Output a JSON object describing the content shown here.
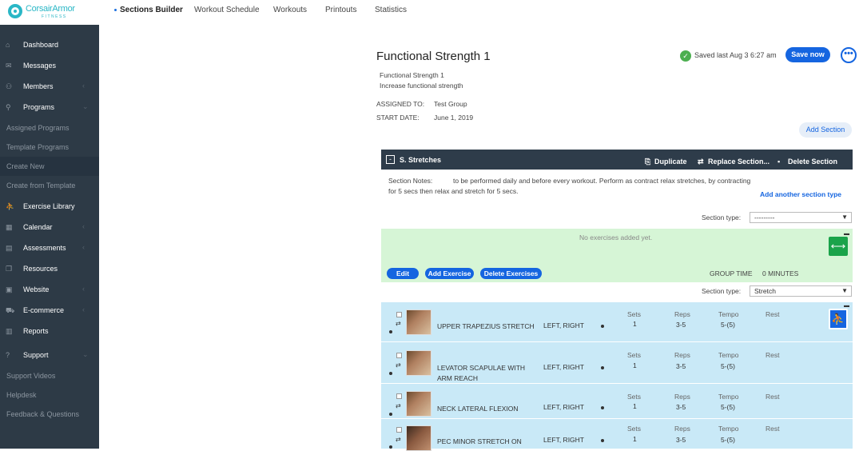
{
  "brand": {
    "name": "CorsairArmor",
    "tagline": "FITNESS"
  },
  "topnav": [
    "Sections Builder",
    "Workout Schedule",
    "Workouts",
    "Printouts",
    "Statistics"
  ],
  "sidebar": {
    "items": [
      {
        "label": "Dashboard",
        "icon": "home-icon"
      },
      {
        "label": "Messages",
        "icon": "envelope-icon"
      },
      {
        "label": "Members",
        "icon": "users-icon"
      },
      {
        "label": "Programs",
        "icon": "tree-icon"
      },
      {
        "label": "Exercise Library",
        "icon": "running-icon"
      },
      {
        "label": "Calendar",
        "icon": "calendar-icon"
      },
      {
        "label": "Assessments",
        "icon": "clipboard-icon"
      },
      {
        "label": "Resources",
        "icon": "files-icon"
      },
      {
        "label": "Website",
        "icon": "browser-icon"
      },
      {
        "label": "E-commerce",
        "icon": "cart-icon"
      },
      {
        "label": "Reports",
        "icon": "report-icon"
      },
      {
        "label": "Support",
        "icon": "question-icon"
      }
    ],
    "program_sub": [
      "Assigned Programs",
      "Template Programs",
      "Create New",
      "Create from Template"
    ],
    "support_sub": [
      "Support Videos",
      "Helpdesk",
      "Feedback & Questions"
    ]
  },
  "program": {
    "title": "Functional Strength 1",
    "subtitle": "Functional Strength 1",
    "description": "Increase functional strength",
    "assigned_label": "ASSIGNED TO:",
    "assigned_value": "Test Group",
    "start_label": "START DATE:",
    "start_value": "June 1, 2019",
    "saved_text": "Saved last Aug 3 6:27 am",
    "save_label": "Save now",
    "more_label": "•••",
    "add_section_label": "Add Section"
  },
  "section": {
    "name": "S. Stretches",
    "toggle": "-",
    "duplicate": "Duplicate",
    "replace": "Replace Section...",
    "delete": "Delete Section",
    "notes_label": "Section Notes:",
    "notes_line1": "to be performed daily and before every workout. Perform as contract relax stretches, by contracting",
    "notes_line2": "for 5 secs then relax and stretch for 5 secs.",
    "add_another": "Add another section type",
    "section_type_label": "Section type:",
    "section_type_value": "---------",
    "no_exercises": "No exercises added yet.",
    "edit_label": "Edit",
    "add_exercise_label": "Add Exercise",
    "delete_exercises_label": "Delete Exercises",
    "group_time_label": "GROUP TIME",
    "group_time_value": "0 MINUTES",
    "section_type2_label": "Section type:",
    "section_type2_value": "Stretch"
  },
  "exercise_headers": {
    "sets": "Sets",
    "reps": "Reps",
    "tempo": "Tempo",
    "rest": "Rest"
  },
  "exercises": [
    {
      "name": "UPPER TRAPEZIUS STRETCH",
      "side": "LEFT, RIGHT",
      "sets": "1",
      "reps": "3-5",
      "tempo": "5-(5)",
      "rest": ""
    },
    {
      "name": "LEVATOR SCAPULAE WITH ARM REACH",
      "side": "LEFT, RIGHT",
      "sets": "1",
      "reps": "3-5",
      "tempo": "5-(5)",
      "rest": ""
    },
    {
      "name": "NECK LATERAL FLEXION",
      "side": "LEFT, RIGHT",
      "sets": "1",
      "reps": "3-5",
      "tempo": "5-(5)",
      "rest": ""
    },
    {
      "name": "PEC MINOR STRETCH ON",
      "side": "LEFT, RIGHT",
      "sets": "1",
      "reps": "3-5",
      "tempo": "5-(5)",
      "rest": ""
    }
  ]
}
